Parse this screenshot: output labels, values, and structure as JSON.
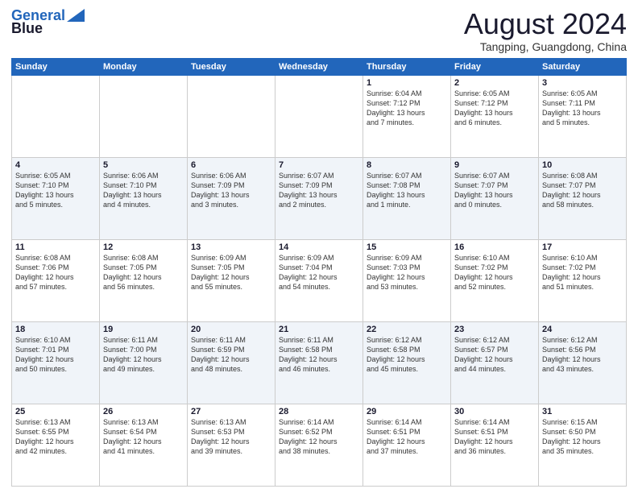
{
  "header": {
    "logo_line1": "General",
    "logo_line2": "Blue",
    "month_year": "August 2024",
    "location": "Tangping, Guangdong, China"
  },
  "days_of_week": [
    "Sunday",
    "Monday",
    "Tuesday",
    "Wednesday",
    "Thursday",
    "Friday",
    "Saturday"
  ],
  "weeks": [
    [
      {
        "day": "",
        "info": ""
      },
      {
        "day": "",
        "info": ""
      },
      {
        "day": "",
        "info": ""
      },
      {
        "day": "",
        "info": ""
      },
      {
        "day": "1",
        "info": "Sunrise: 6:04 AM\nSunset: 7:12 PM\nDaylight: 13 hours\nand 7 minutes."
      },
      {
        "day": "2",
        "info": "Sunrise: 6:05 AM\nSunset: 7:12 PM\nDaylight: 13 hours\nand 6 minutes."
      },
      {
        "day": "3",
        "info": "Sunrise: 6:05 AM\nSunset: 7:11 PM\nDaylight: 13 hours\nand 5 minutes."
      }
    ],
    [
      {
        "day": "4",
        "info": "Sunrise: 6:05 AM\nSunset: 7:10 PM\nDaylight: 13 hours\nand 5 minutes."
      },
      {
        "day": "5",
        "info": "Sunrise: 6:06 AM\nSunset: 7:10 PM\nDaylight: 13 hours\nand 4 minutes."
      },
      {
        "day": "6",
        "info": "Sunrise: 6:06 AM\nSunset: 7:09 PM\nDaylight: 13 hours\nand 3 minutes."
      },
      {
        "day": "7",
        "info": "Sunrise: 6:07 AM\nSunset: 7:09 PM\nDaylight: 13 hours\nand 2 minutes."
      },
      {
        "day": "8",
        "info": "Sunrise: 6:07 AM\nSunset: 7:08 PM\nDaylight: 13 hours\nand 1 minute."
      },
      {
        "day": "9",
        "info": "Sunrise: 6:07 AM\nSunset: 7:07 PM\nDaylight: 13 hours\nand 0 minutes."
      },
      {
        "day": "10",
        "info": "Sunrise: 6:08 AM\nSunset: 7:07 PM\nDaylight: 12 hours\nand 58 minutes."
      }
    ],
    [
      {
        "day": "11",
        "info": "Sunrise: 6:08 AM\nSunset: 7:06 PM\nDaylight: 12 hours\nand 57 minutes."
      },
      {
        "day": "12",
        "info": "Sunrise: 6:08 AM\nSunset: 7:05 PM\nDaylight: 12 hours\nand 56 minutes."
      },
      {
        "day": "13",
        "info": "Sunrise: 6:09 AM\nSunset: 7:05 PM\nDaylight: 12 hours\nand 55 minutes."
      },
      {
        "day": "14",
        "info": "Sunrise: 6:09 AM\nSunset: 7:04 PM\nDaylight: 12 hours\nand 54 minutes."
      },
      {
        "day": "15",
        "info": "Sunrise: 6:09 AM\nSunset: 7:03 PM\nDaylight: 12 hours\nand 53 minutes."
      },
      {
        "day": "16",
        "info": "Sunrise: 6:10 AM\nSunset: 7:02 PM\nDaylight: 12 hours\nand 52 minutes."
      },
      {
        "day": "17",
        "info": "Sunrise: 6:10 AM\nSunset: 7:02 PM\nDaylight: 12 hours\nand 51 minutes."
      }
    ],
    [
      {
        "day": "18",
        "info": "Sunrise: 6:10 AM\nSunset: 7:01 PM\nDaylight: 12 hours\nand 50 minutes."
      },
      {
        "day": "19",
        "info": "Sunrise: 6:11 AM\nSunset: 7:00 PM\nDaylight: 12 hours\nand 49 minutes."
      },
      {
        "day": "20",
        "info": "Sunrise: 6:11 AM\nSunset: 6:59 PM\nDaylight: 12 hours\nand 48 minutes."
      },
      {
        "day": "21",
        "info": "Sunrise: 6:11 AM\nSunset: 6:58 PM\nDaylight: 12 hours\nand 46 minutes."
      },
      {
        "day": "22",
        "info": "Sunrise: 6:12 AM\nSunset: 6:58 PM\nDaylight: 12 hours\nand 45 minutes."
      },
      {
        "day": "23",
        "info": "Sunrise: 6:12 AM\nSunset: 6:57 PM\nDaylight: 12 hours\nand 44 minutes."
      },
      {
        "day": "24",
        "info": "Sunrise: 6:12 AM\nSunset: 6:56 PM\nDaylight: 12 hours\nand 43 minutes."
      }
    ],
    [
      {
        "day": "25",
        "info": "Sunrise: 6:13 AM\nSunset: 6:55 PM\nDaylight: 12 hours\nand 42 minutes."
      },
      {
        "day": "26",
        "info": "Sunrise: 6:13 AM\nSunset: 6:54 PM\nDaylight: 12 hours\nand 41 minutes."
      },
      {
        "day": "27",
        "info": "Sunrise: 6:13 AM\nSunset: 6:53 PM\nDaylight: 12 hours\nand 39 minutes."
      },
      {
        "day": "28",
        "info": "Sunrise: 6:14 AM\nSunset: 6:52 PM\nDaylight: 12 hours\nand 38 minutes."
      },
      {
        "day": "29",
        "info": "Sunrise: 6:14 AM\nSunset: 6:51 PM\nDaylight: 12 hours\nand 37 minutes."
      },
      {
        "day": "30",
        "info": "Sunrise: 6:14 AM\nSunset: 6:51 PM\nDaylight: 12 hours\nand 36 minutes."
      },
      {
        "day": "31",
        "info": "Sunrise: 6:15 AM\nSunset: 6:50 PM\nDaylight: 12 hours\nand 35 minutes."
      }
    ]
  ]
}
